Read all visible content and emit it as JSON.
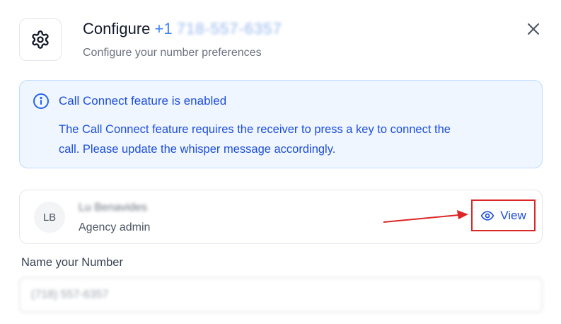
{
  "header": {
    "title_prefix": "Configure",
    "title_number_visible": "+1",
    "title_number_blurred": "718-557-6357",
    "subtitle": "Configure your number preferences"
  },
  "alert": {
    "title": "Call Connect feature is enabled",
    "body": "The Call Connect feature requires the receiver to press a key to connect the call. Please update the whisper message accordingly."
  },
  "user": {
    "initials": "LB",
    "name": "Lu Benavides",
    "role": "Agency admin",
    "view_label": "View"
  },
  "name_field": {
    "label": "Name your Number",
    "value": "(718) 557-6357"
  },
  "colors": {
    "accent": "#1d4ed8",
    "alert_bg": "#eff6ff",
    "highlight": "#dc2626"
  }
}
